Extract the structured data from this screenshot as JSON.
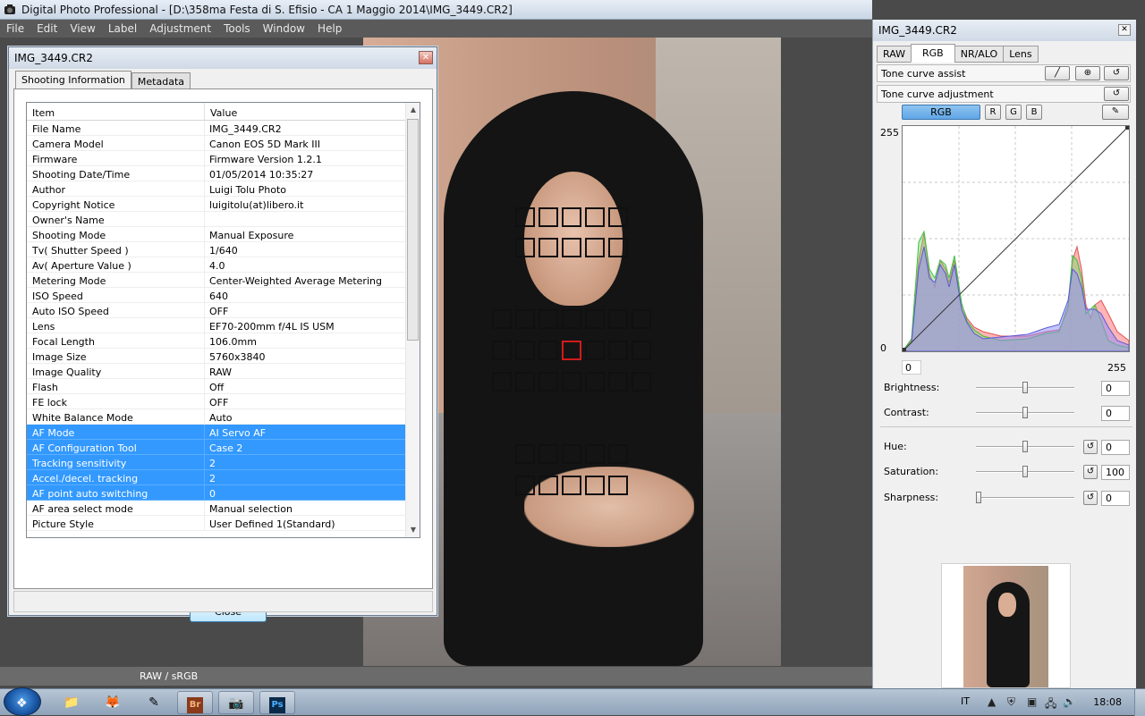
{
  "window": {
    "title": "Digital Photo Professional - [D:\\358ma Festa di S. Efisio - CA 1 Maggio 2014\\IMG_3449.CR2]"
  },
  "menu": [
    "File",
    "Edit",
    "View",
    "Label",
    "Adjustment",
    "Tools",
    "Window",
    "Help"
  ],
  "status": {
    "text": "RAW / sRGB"
  },
  "dialog": {
    "title": "IMG_3449.CR2",
    "tabs": [
      "Shooting Information",
      "Metadata"
    ],
    "columns": [
      "Item",
      "Value"
    ],
    "rows": [
      {
        "item": "File Name",
        "value": "IMG_3449.CR2"
      },
      {
        "item": "Camera Model",
        "value": "Canon EOS 5D Mark III"
      },
      {
        "item": "Firmware",
        "value": "Firmware Version 1.2.1"
      },
      {
        "item": "Shooting Date/Time",
        "value": "01/05/2014 10:35:27"
      },
      {
        "item": "Author",
        "value": "Luigi Tolu Photo"
      },
      {
        "item": "Copyright Notice",
        "value": "luigitolu(at)libero.it"
      },
      {
        "item": "Owner's Name",
        "value": ""
      },
      {
        "item": "Shooting Mode",
        "value": "Manual Exposure"
      },
      {
        "item": "Tv( Shutter Speed )",
        "value": "1/640"
      },
      {
        "item": "Av( Aperture Value )",
        "value": "4.0"
      },
      {
        "item": "Metering Mode",
        "value": "Center-Weighted Average Metering"
      },
      {
        "item": "ISO Speed",
        "value": "640"
      },
      {
        "item": "Auto ISO Speed",
        "value": "OFF"
      },
      {
        "item": "Lens",
        "value": "EF70-200mm f/4L IS USM"
      },
      {
        "item": "Focal Length",
        "value": "106.0mm"
      },
      {
        "item": "Image Size",
        "value": "5760x3840"
      },
      {
        "item": "Image Quality",
        "value": "RAW"
      },
      {
        "item": "Flash",
        "value": "Off"
      },
      {
        "item": "FE lock",
        "value": "OFF"
      },
      {
        "item": "White Balance Mode",
        "value": "Auto"
      },
      {
        "item": "AF Mode",
        "value": "AI Servo AF",
        "highlight": true
      },
      {
        "item": "AF Configuration Tool",
        "value": "Case 2",
        "highlight": true
      },
      {
        "item": "Tracking sensitivity",
        "value": "2",
        "highlight": true
      },
      {
        "item": "Accel./decel. tracking",
        "value": "2",
        "highlight": true
      },
      {
        "item": "AF point auto switching",
        "value": "0",
        "highlight": true
      },
      {
        "item": "AF area select mode",
        "value": "Manual selection"
      },
      {
        "item": "Picture Style",
        "value": "User Defined 1(Standard)"
      }
    ],
    "close_label": "Close"
  },
  "tool": {
    "title": "IMG_3449.CR2",
    "tabs": [
      "RAW",
      "RGB",
      "NR/ALO",
      "Lens"
    ],
    "active_tab": "RGB",
    "tone_curve_assist": "Tone curve assist",
    "tone_curve_adjustment": "Tone curve adjustment",
    "channels": [
      "RGB",
      "R",
      "G",
      "B"
    ],
    "hist_top": "255",
    "hist_bottom": "0",
    "input_min": "0",
    "input_max": "255",
    "sliders": [
      {
        "label": "Brightness:",
        "value": "0",
        "pos": 0.5,
        "reset": false
      },
      {
        "label": "Contrast:",
        "value": "0",
        "pos": 0.5,
        "reset": false
      },
      {
        "label": "Hue:",
        "value": "0",
        "pos": 0.5,
        "reset": true
      },
      {
        "label": "Saturation:",
        "value": "100",
        "pos": 0.5,
        "reset": true
      },
      {
        "label": "Sharpness:",
        "value": "0",
        "pos": 0.0,
        "reset": true
      }
    ]
  },
  "taskbar": {
    "lang": "IT",
    "clock": "18:08"
  },
  "colors": {
    "selection": "#3399ff",
    "af_selected": "#d21a1a"
  }
}
